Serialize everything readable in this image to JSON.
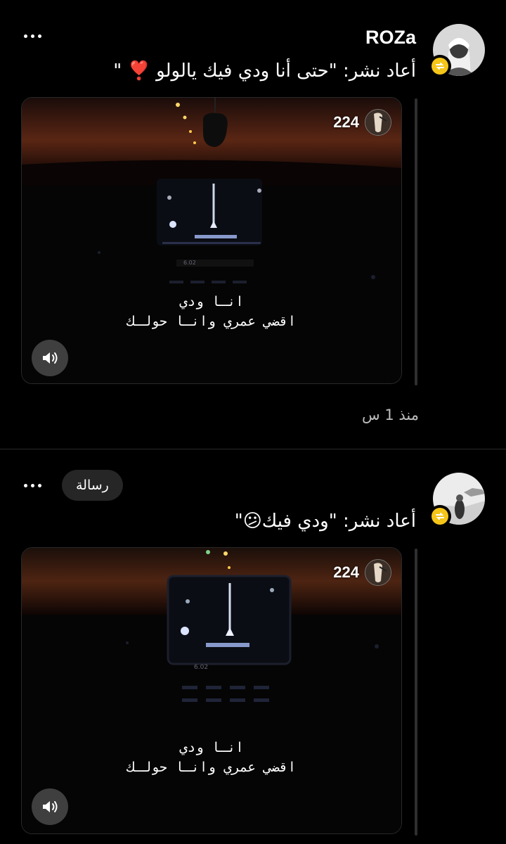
{
  "posts": [
    {
      "username": "ROZa",
      "repost_text": "أعاد نشر: \"حتى أنا ودي فيك يالولو ❣️ \"",
      "views": "224",
      "lyrics_line1": "انـا  ودي",
      "lyrics_line2": "اقضي عمري وانـا حولـك",
      "timestamp": "منذ 1 س"
    },
    {
      "message_label": "رسالة",
      "repost_text": "أعاد نشر: \"ودي فيك😕\"",
      "views": "224",
      "lyrics_line1": "انـا  ودي",
      "lyrics_line2": "اقضي عمري وانـا حولـك"
    }
  ],
  "icons": {
    "more": "more-icon",
    "repost": "repost-icon",
    "sound": "sound-icon",
    "avatar": "avatar"
  },
  "colors": {
    "background": "#000000",
    "repost_badge": "#f5c518",
    "divider": "#2a2a2a",
    "timestamp": "#bdbdbd"
  }
}
